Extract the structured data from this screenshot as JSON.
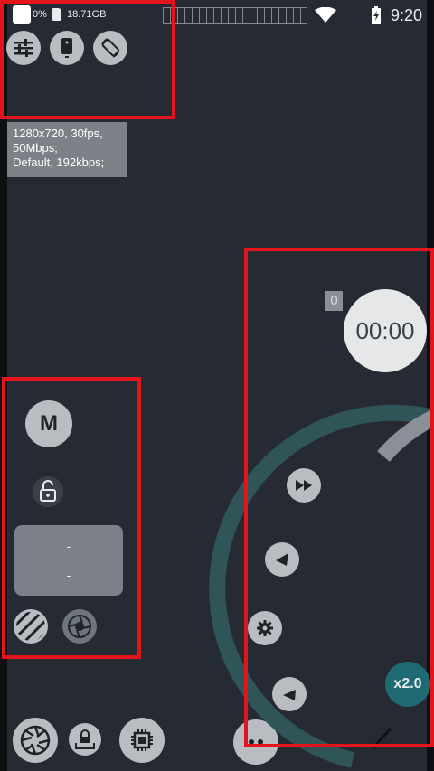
{
  "status_bar": {
    "battery_percent": "0%",
    "storage": "18.71GB",
    "time": "9:20"
  },
  "info": {
    "video_line1": "1280x720, 30fps,",
    "video_line2": "50Mbps;",
    "audio_line": "Default, 192kbps;"
  },
  "controls": {
    "mode_label": "M",
    "panel_line1": "-",
    "panel_line2": "-"
  },
  "recording": {
    "counter": "0",
    "timer": "00:00",
    "zoom_label": "x2.0"
  },
  "colors": {
    "background": "#262b33",
    "accent_teal": "#1f6b73",
    "highlight_red": "#e3141b"
  }
}
